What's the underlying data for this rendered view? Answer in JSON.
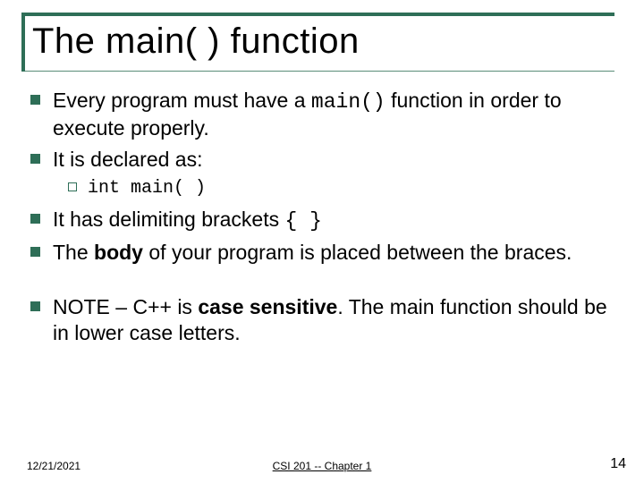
{
  "title": "The main( ) function",
  "bullets": {
    "b1_pre": "Every program must have a ",
    "b1_code": "main()",
    "b1_post": " function in order to execute properly.",
    "b2": "It is declared as:",
    "b2_sub": "int main( )",
    "b3_pre": "It has delimiting brackets ",
    "b3_code": "{ }",
    "b4_pre": "The ",
    "b4_bold": "body",
    "b4_post": " of your program is placed between the braces.",
    "b5_pre": "NOTE – C++ is ",
    "b5_bold": "case sensitive",
    "b5_post": ". The main function should be in lower case letters."
  },
  "footer": {
    "date": "12/21/2021",
    "center": "CSI 201 -- Chapter 1",
    "page": "14"
  }
}
